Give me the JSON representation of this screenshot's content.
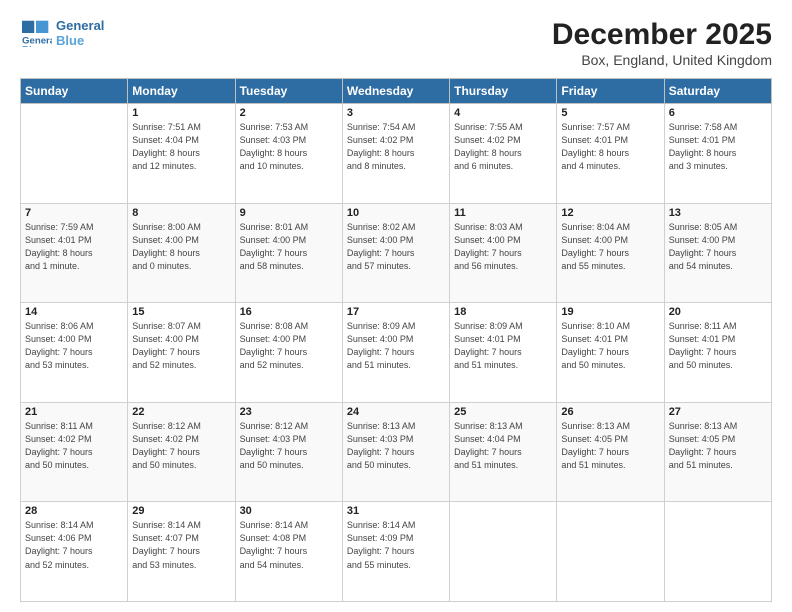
{
  "header": {
    "logo_line1": "General",
    "logo_line2": "Blue",
    "month": "December 2025",
    "location": "Box, England, United Kingdom"
  },
  "days_of_week": [
    "Sunday",
    "Monday",
    "Tuesday",
    "Wednesday",
    "Thursday",
    "Friday",
    "Saturday"
  ],
  "weeks": [
    [
      {
        "day": "",
        "info": ""
      },
      {
        "day": "1",
        "info": "Sunrise: 7:51 AM\nSunset: 4:04 PM\nDaylight: 8 hours\nand 12 minutes."
      },
      {
        "day": "2",
        "info": "Sunrise: 7:53 AM\nSunset: 4:03 PM\nDaylight: 8 hours\nand 10 minutes."
      },
      {
        "day": "3",
        "info": "Sunrise: 7:54 AM\nSunset: 4:02 PM\nDaylight: 8 hours\nand 8 minutes."
      },
      {
        "day": "4",
        "info": "Sunrise: 7:55 AM\nSunset: 4:02 PM\nDaylight: 8 hours\nand 6 minutes."
      },
      {
        "day": "5",
        "info": "Sunrise: 7:57 AM\nSunset: 4:01 PM\nDaylight: 8 hours\nand 4 minutes."
      },
      {
        "day": "6",
        "info": "Sunrise: 7:58 AM\nSunset: 4:01 PM\nDaylight: 8 hours\nand 3 minutes."
      }
    ],
    [
      {
        "day": "7",
        "info": "Sunrise: 7:59 AM\nSunset: 4:01 PM\nDaylight: 8 hours\nand 1 minute."
      },
      {
        "day": "8",
        "info": "Sunrise: 8:00 AM\nSunset: 4:00 PM\nDaylight: 8 hours\nand 0 minutes."
      },
      {
        "day": "9",
        "info": "Sunrise: 8:01 AM\nSunset: 4:00 PM\nDaylight: 7 hours\nand 58 minutes."
      },
      {
        "day": "10",
        "info": "Sunrise: 8:02 AM\nSunset: 4:00 PM\nDaylight: 7 hours\nand 57 minutes."
      },
      {
        "day": "11",
        "info": "Sunrise: 8:03 AM\nSunset: 4:00 PM\nDaylight: 7 hours\nand 56 minutes."
      },
      {
        "day": "12",
        "info": "Sunrise: 8:04 AM\nSunset: 4:00 PM\nDaylight: 7 hours\nand 55 minutes."
      },
      {
        "day": "13",
        "info": "Sunrise: 8:05 AM\nSunset: 4:00 PM\nDaylight: 7 hours\nand 54 minutes."
      }
    ],
    [
      {
        "day": "14",
        "info": "Sunrise: 8:06 AM\nSunset: 4:00 PM\nDaylight: 7 hours\nand 53 minutes."
      },
      {
        "day": "15",
        "info": "Sunrise: 8:07 AM\nSunset: 4:00 PM\nDaylight: 7 hours\nand 52 minutes."
      },
      {
        "day": "16",
        "info": "Sunrise: 8:08 AM\nSunset: 4:00 PM\nDaylight: 7 hours\nand 52 minutes."
      },
      {
        "day": "17",
        "info": "Sunrise: 8:09 AM\nSunset: 4:00 PM\nDaylight: 7 hours\nand 51 minutes."
      },
      {
        "day": "18",
        "info": "Sunrise: 8:09 AM\nSunset: 4:01 PM\nDaylight: 7 hours\nand 51 minutes."
      },
      {
        "day": "19",
        "info": "Sunrise: 8:10 AM\nSunset: 4:01 PM\nDaylight: 7 hours\nand 50 minutes."
      },
      {
        "day": "20",
        "info": "Sunrise: 8:11 AM\nSunset: 4:01 PM\nDaylight: 7 hours\nand 50 minutes."
      }
    ],
    [
      {
        "day": "21",
        "info": "Sunrise: 8:11 AM\nSunset: 4:02 PM\nDaylight: 7 hours\nand 50 minutes."
      },
      {
        "day": "22",
        "info": "Sunrise: 8:12 AM\nSunset: 4:02 PM\nDaylight: 7 hours\nand 50 minutes."
      },
      {
        "day": "23",
        "info": "Sunrise: 8:12 AM\nSunset: 4:03 PM\nDaylight: 7 hours\nand 50 minutes."
      },
      {
        "day": "24",
        "info": "Sunrise: 8:13 AM\nSunset: 4:03 PM\nDaylight: 7 hours\nand 50 minutes."
      },
      {
        "day": "25",
        "info": "Sunrise: 8:13 AM\nSunset: 4:04 PM\nDaylight: 7 hours\nand 51 minutes."
      },
      {
        "day": "26",
        "info": "Sunrise: 8:13 AM\nSunset: 4:05 PM\nDaylight: 7 hours\nand 51 minutes."
      },
      {
        "day": "27",
        "info": "Sunrise: 8:13 AM\nSunset: 4:05 PM\nDaylight: 7 hours\nand 51 minutes."
      }
    ],
    [
      {
        "day": "28",
        "info": "Sunrise: 8:14 AM\nSunset: 4:06 PM\nDaylight: 7 hours\nand 52 minutes."
      },
      {
        "day": "29",
        "info": "Sunrise: 8:14 AM\nSunset: 4:07 PM\nDaylight: 7 hours\nand 53 minutes."
      },
      {
        "day": "30",
        "info": "Sunrise: 8:14 AM\nSunset: 4:08 PM\nDaylight: 7 hours\nand 54 minutes."
      },
      {
        "day": "31",
        "info": "Sunrise: 8:14 AM\nSunset: 4:09 PM\nDaylight: 7 hours\nand 55 minutes."
      },
      {
        "day": "",
        "info": ""
      },
      {
        "day": "",
        "info": ""
      },
      {
        "day": "",
        "info": ""
      }
    ]
  ]
}
